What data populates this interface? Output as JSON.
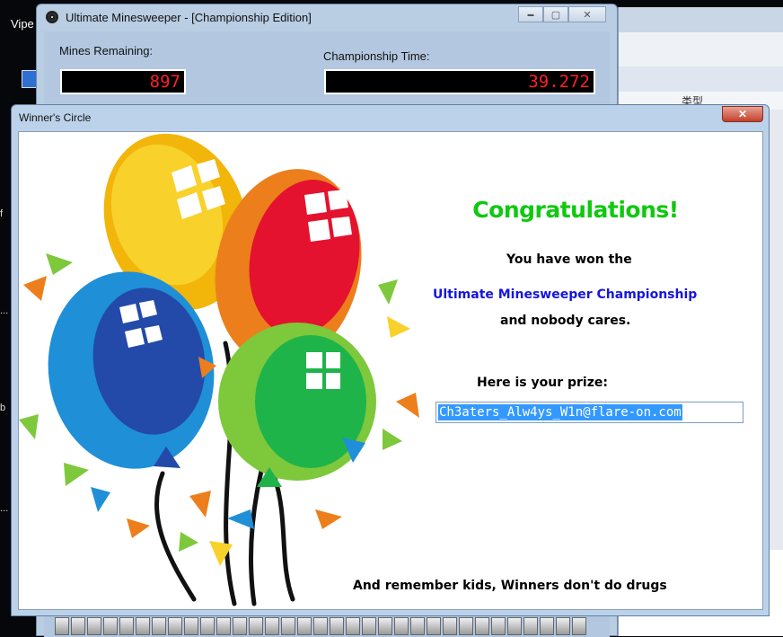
{
  "desktop": {
    "label_top": "Vipe",
    "side_marks": [
      "f",
      "...",
      "b",
      "..."
    ]
  },
  "background_window": {
    "column_label": "类型"
  },
  "minesweeper": {
    "title": "Ultimate Minesweeper - [Championship Edition]",
    "mines_label": "Mines Remaining:",
    "mines_value": "897",
    "time_label": "Championship Time:",
    "time_value": "39.272",
    "controls": {
      "minimize": "▬",
      "maximize": "▢",
      "close": "✕"
    }
  },
  "dialog": {
    "title": "Winner's Circle",
    "close_label": "✕",
    "congrats": "Congratulations!",
    "line1": "You have won the",
    "line2": "Ultimate Minesweeper Championship",
    "line3": "and nobody cares.",
    "prize_label": "Here is your prize:",
    "prize_value": "Ch3aters_Alw4ys_W1n@flare-on.com",
    "footer": "And remember kids, Winners don't do drugs"
  },
  "colors": {
    "congrats_green": "#10c810",
    "championship_blue": "#1515e0",
    "lcd_red": "#ff2020",
    "selection_blue": "#3399ff"
  }
}
